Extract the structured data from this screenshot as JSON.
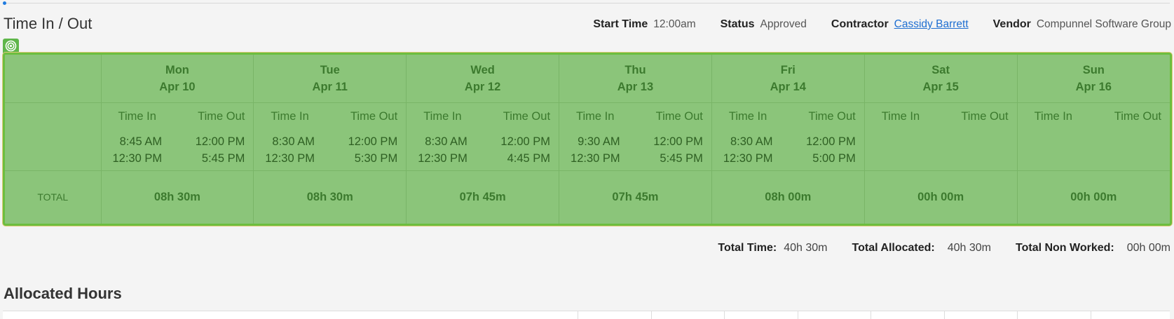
{
  "section": {
    "title": "Time In / Out"
  },
  "meta": {
    "start_time_label": "Start Time",
    "start_time_value": "12:00am",
    "status_label": "Status",
    "status_value": "Approved",
    "contractor_label": "Contractor",
    "contractor_value": "Cassidy Barrett",
    "vendor_label": "Vendor",
    "vendor_value": "Compunnel Software Group"
  },
  "icons": {
    "target": "target-icon"
  },
  "colors": {
    "grid_bg": "#8bc57a",
    "grid_border": "#6cbe3f",
    "link": "#1f6fd1",
    "text_green": "#3c7a2e"
  },
  "labels": {
    "time_in": "Time In",
    "time_out": "Time Out",
    "total": "TOTAL"
  },
  "days": [
    {
      "dow": "Mon",
      "date": "Apr 10",
      "in": [
        "8:45 AM",
        "12:30 PM"
      ],
      "out": [
        "12:00 PM",
        "5:45 PM"
      ],
      "total": "08h 30m"
    },
    {
      "dow": "Tue",
      "date": "Apr 11",
      "in": [
        "8:30 AM",
        "12:30 PM"
      ],
      "out": [
        "12:00 PM",
        "5:30 PM"
      ],
      "total": "08h 30m"
    },
    {
      "dow": "Wed",
      "date": "Apr 12",
      "in": [
        "8:30 AM",
        "12:30 PM"
      ],
      "out": [
        "12:00 PM",
        "4:45 PM"
      ],
      "total": "07h 45m"
    },
    {
      "dow": "Thu",
      "date": "Apr 13",
      "in": [
        "9:30 AM",
        "12:30 PM"
      ],
      "out": [
        "12:00 PM",
        "5:45 PM"
      ],
      "total": "07h 45m"
    },
    {
      "dow": "Fri",
      "date": "Apr 14",
      "in": [
        "8:30 AM",
        "12:30 PM"
      ],
      "out": [
        "12:00 PM",
        "5:00 PM"
      ],
      "total": "08h 00m"
    },
    {
      "dow": "Sat",
      "date": "Apr 15",
      "in": [],
      "out": [],
      "total": "00h 00m"
    },
    {
      "dow": "Sun",
      "date": "Apr 16",
      "in": [],
      "out": [],
      "total": "00h 00m"
    }
  ],
  "summary": {
    "total_time_label": "Total Time:",
    "total_time_value": "40h 30m",
    "total_allocated_label": "Total Allocated:",
    "total_allocated_value": "40h 30m",
    "total_non_worked_label": "Total Non Worked:",
    "total_non_worked_value": "00h 00m"
  },
  "allocated": {
    "title": "Allocated Hours"
  }
}
